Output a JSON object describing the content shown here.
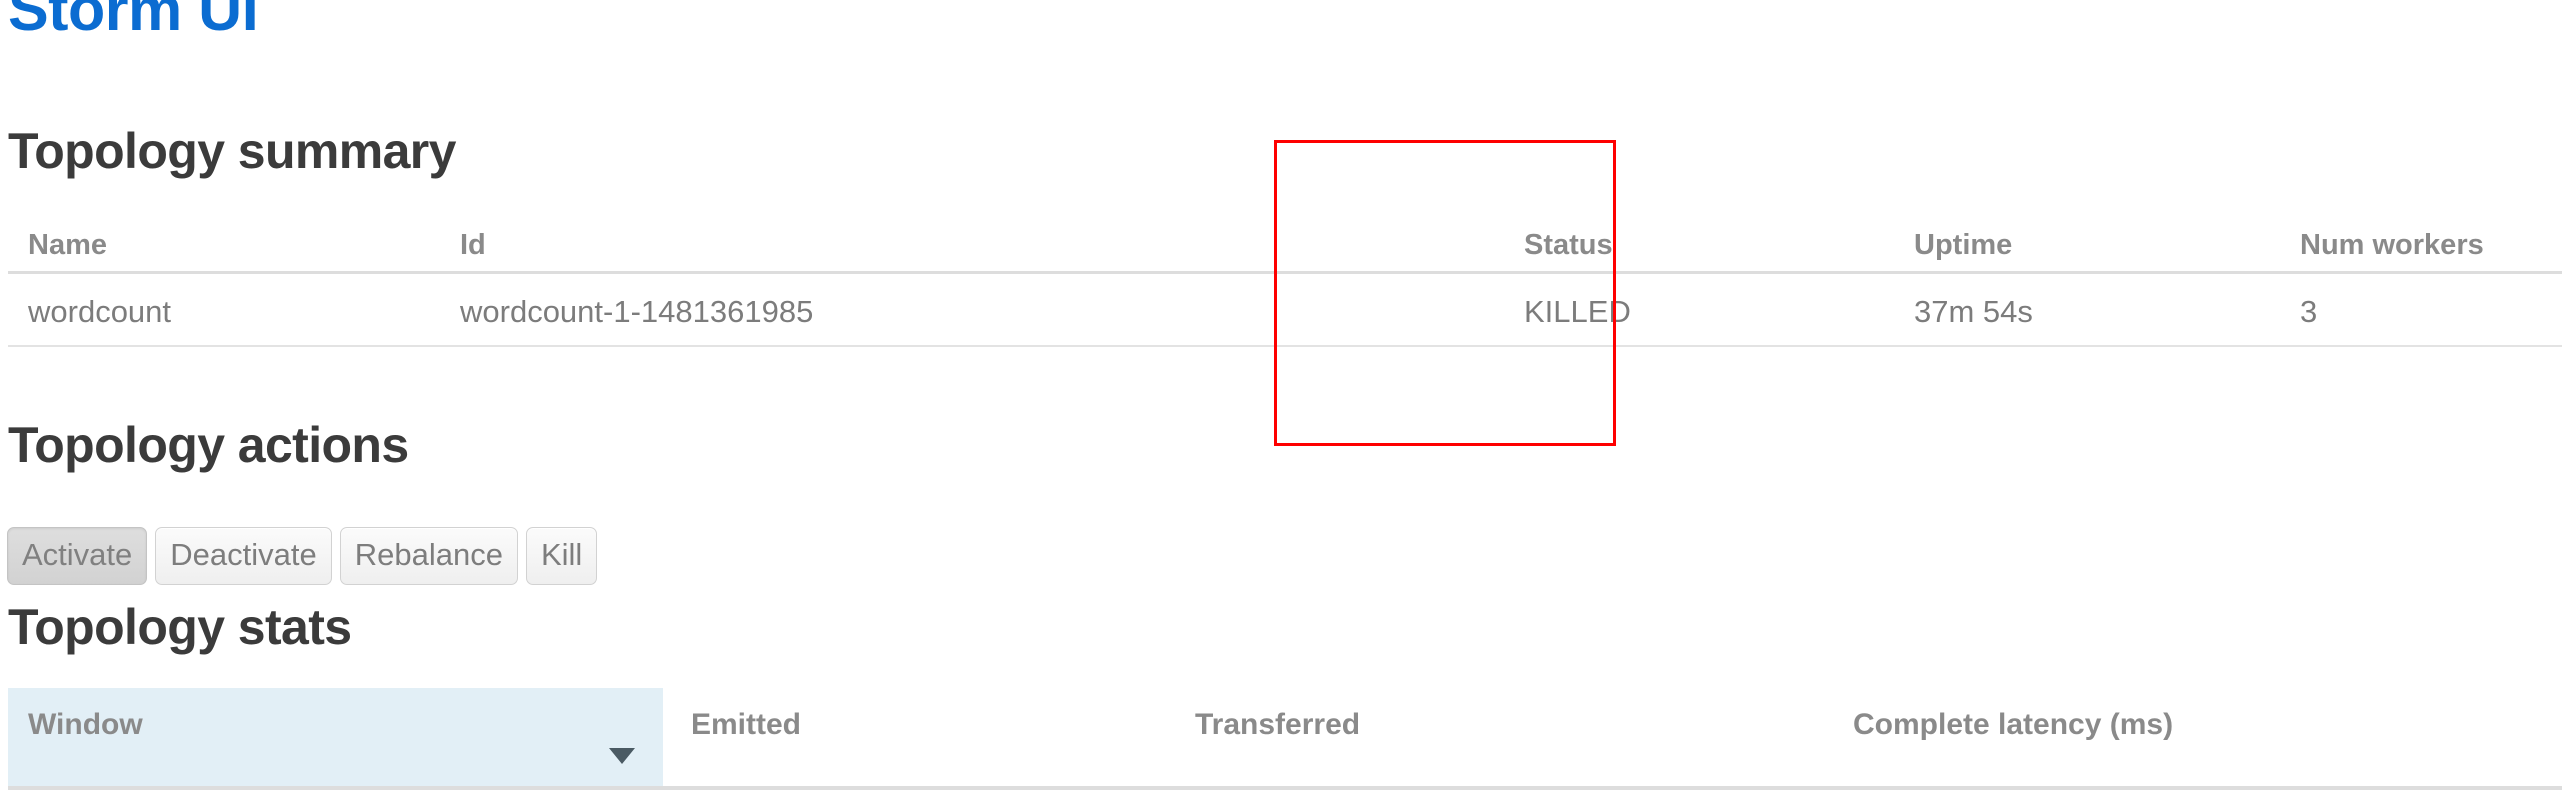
{
  "app": {
    "brand_title": "Storm UI",
    "brand_color": "#0b6cd1"
  },
  "annotation": {
    "highlight_color": "#fe0000",
    "target": "status-column"
  },
  "topology_summary": {
    "heading": "Topology summary",
    "columns": [
      "Name",
      "Id",
      "Status",
      "Uptime",
      "Num workers"
    ],
    "rows": [
      {
        "name": "wordcount",
        "id": "wordcount-1-1481361985",
        "status": "KILLED",
        "uptime": "37m 54s",
        "num_workers": "3"
      }
    ]
  },
  "topology_actions": {
    "heading": "Topology actions",
    "buttons": [
      {
        "label": "Activate",
        "state": "active"
      },
      {
        "label": "Deactivate",
        "state": "normal"
      },
      {
        "label": "Rebalance",
        "state": "normal"
      },
      {
        "label": "Kill",
        "state": "normal"
      }
    ]
  },
  "topology_stats": {
    "heading": "Topology stats",
    "columns": [
      "Window",
      "Emitted",
      "Transferred",
      "Complete latency (ms)"
    ],
    "sorted_column": "Window",
    "sort_icon": "caret-down-icon",
    "sort_highlight_color": "#e2eff6",
    "rows": []
  }
}
